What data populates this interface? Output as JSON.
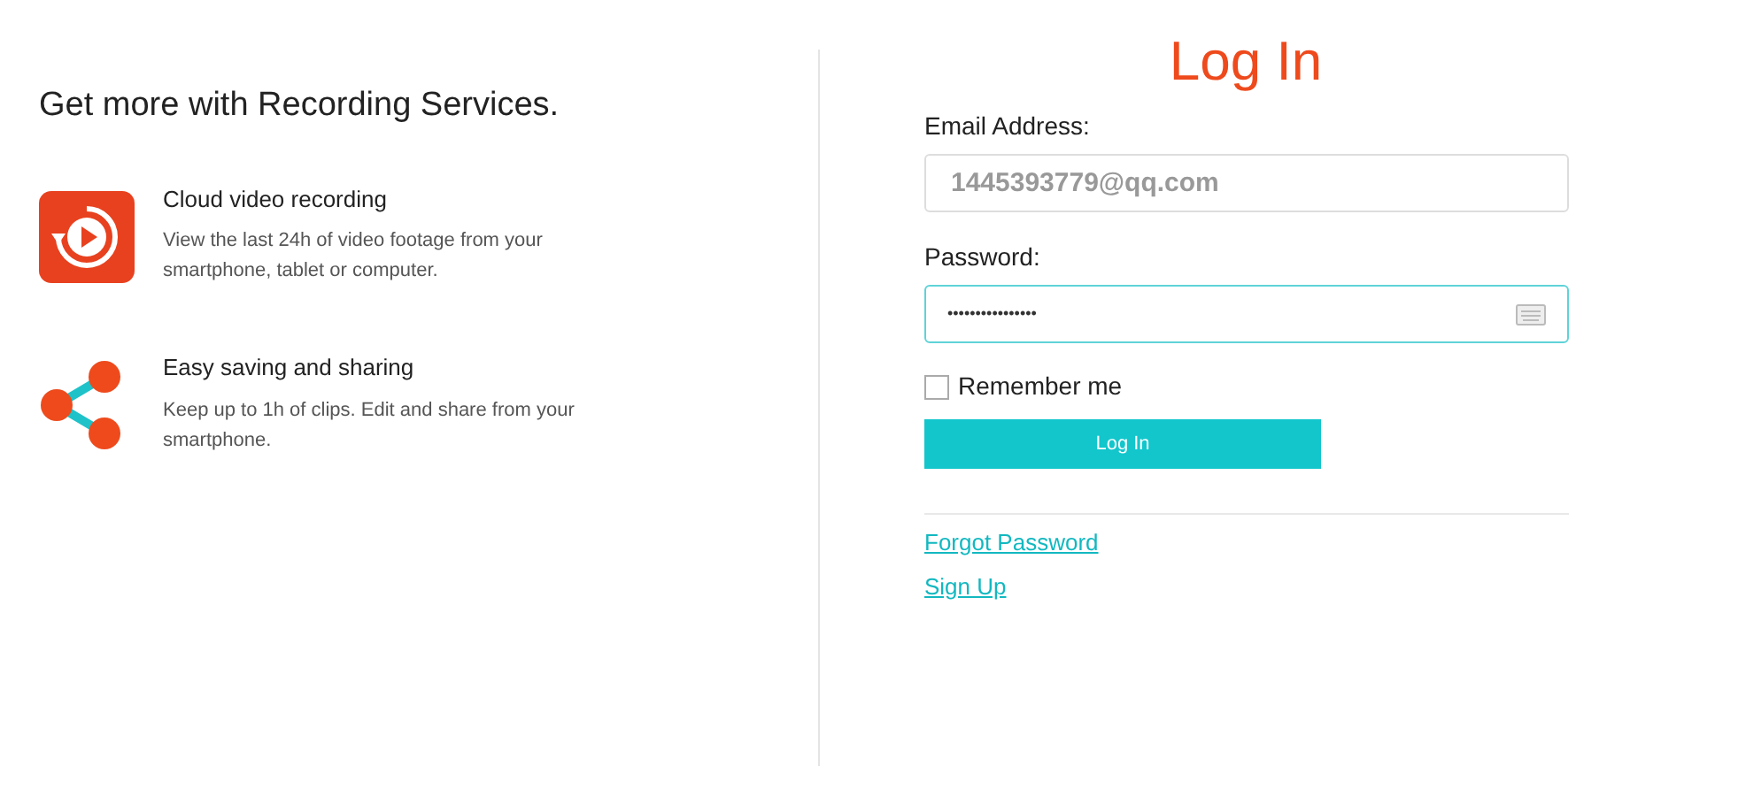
{
  "promo": {
    "heading": "Get more with Recording Services.",
    "features": [
      {
        "kind": "video",
        "title": "Cloud video recording",
        "description": "View the last 24h of video footage from your smartphone, tablet or computer."
      },
      {
        "kind": "share",
        "title": "Easy saving and sharing",
        "description": "Keep up to 1h of clips. Edit and share from your smartphone."
      }
    ]
  },
  "login": {
    "title": "Log In",
    "email": {
      "label": "Email Address:",
      "value": "1445393779@qq.com"
    },
    "password": {
      "label": "Password:",
      "value": "••••••••••••••••",
      "focused": true
    },
    "remember": {
      "label": "Remember me",
      "checked": false
    },
    "submit": "Log In",
    "links": [
      "Forgot Password",
      "Sign Up"
    ]
  }
}
